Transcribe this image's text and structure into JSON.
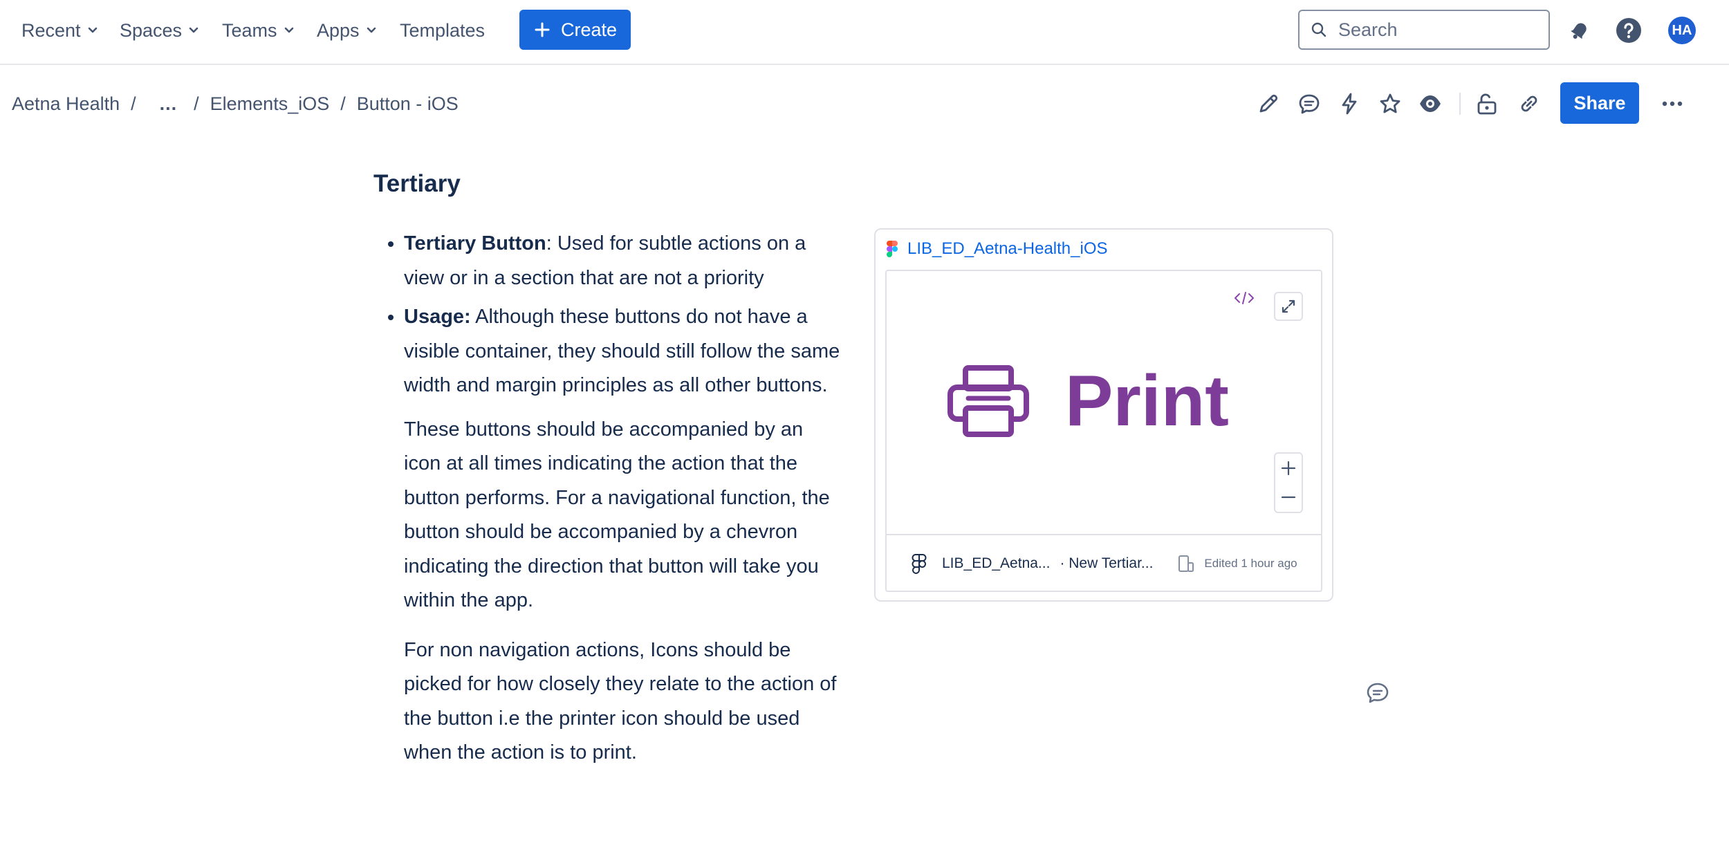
{
  "topnav": {
    "items": [
      {
        "label": "Recent",
        "has_dropdown": true
      },
      {
        "label": "Spaces",
        "has_dropdown": true
      },
      {
        "label": "Teams",
        "has_dropdown": true
      },
      {
        "label": "Apps",
        "has_dropdown": true
      },
      {
        "label": "Templates",
        "has_dropdown": false
      }
    ],
    "create_label": "Create",
    "search_placeholder": "Search",
    "avatar_initials": "HA",
    "icons": [
      "notifications-icon",
      "help-icon"
    ]
  },
  "breadcrumb": {
    "items": [
      "Aetna Health",
      "...",
      "Elements_iOS",
      "Button - iOS"
    ]
  },
  "page_toolbar": {
    "icons": [
      "edit-icon",
      "comment-icon",
      "automation-icon",
      "star-icon",
      "watch-icon",
      "restrictions-icon",
      "copy-link-icon"
    ],
    "share_label": "Share"
  },
  "content": {
    "heading": "Tertiary",
    "bullets": [
      {
        "term": "Tertiary Button",
        "text": ": Used for subtle actions on a view or in a section that are not a priority"
      },
      {
        "term": "Usage:",
        "text": " Although these buttons do not have a visible container, they should still follow the same width and margin principles as all other buttons."
      }
    ],
    "paragraphs": [
      "These buttons should be accompanied by an icon at all times indicating the action that the button performs. For a navigational function, the button should be accompanied by a chevron indicating the direction that button will take you within the app.",
      "For non navigation actions, Icons should be picked for how closely they relate to the action of the button i.e the printer icon should be used when the action is to print."
    ]
  },
  "embed": {
    "title": "LIB_ED_Aetna-Health_iOS",
    "preview_label": "Print",
    "footer_file": "LIB_ED_Aetna...",
    "footer_frame": "· New Tertiar...",
    "footer_edited": "Edited 1 hour ago",
    "accent_color": "#7d3c98"
  },
  "colors": {
    "brand_blue": "#1868db",
    "text": "#172b4d",
    "subtle_text": "#44546f"
  }
}
